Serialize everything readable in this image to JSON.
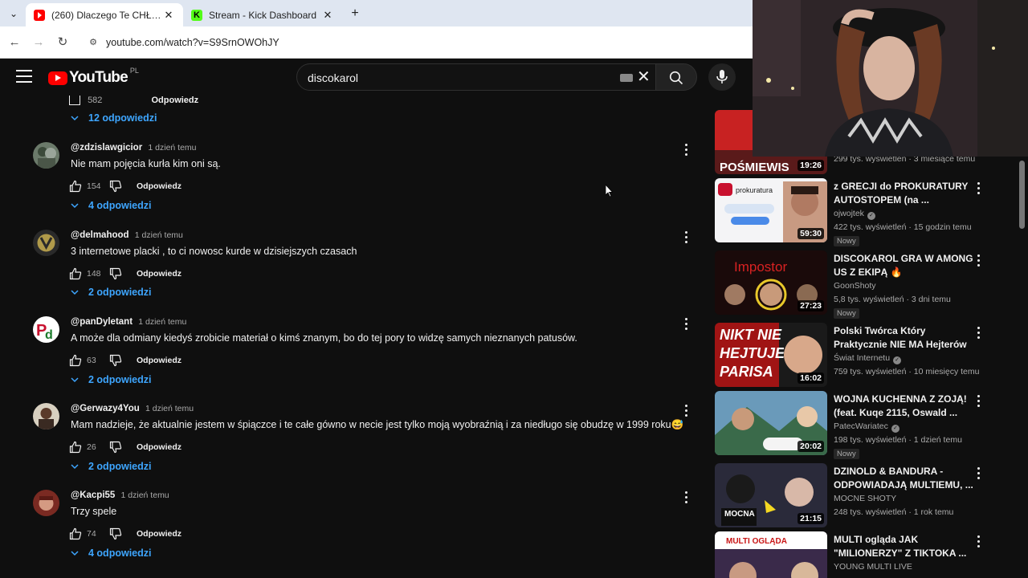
{
  "browser": {
    "tabs": [
      {
        "title": "(260) Dlaczego Te CHŁOPAKI P…",
        "favicon": "youtube-icon",
        "active": true
      },
      {
        "title": "Stream - Kick Dashboard",
        "favicon": "kick-icon",
        "active": false
      }
    ],
    "url": "youtube.com/watch?v=S9SrnOWOhJY"
  },
  "header": {
    "logo_text": "YouTube",
    "country_code": "PL",
    "search_query": "discokarol"
  },
  "comments": {
    "top_partial": {
      "likes": "582",
      "reply_label": "Odpowiedz"
    },
    "first_replies_label": "12 odpowiedzi",
    "items": [
      {
        "author": "@zdzislawgicior",
        "time": "1 dzień temu",
        "text": "Nie mam pojęcia kurła kim oni są.",
        "likes": "154",
        "reply_label": "Odpowiedz",
        "replies_label": "4 odpowiedzi"
      },
      {
        "author": "@delmahood",
        "time": "1 dzień temu",
        "text": "3 internetowe placki , to ci nowosc kurde w dzisiejszych czasach",
        "likes": "148",
        "reply_label": "Odpowiedz",
        "replies_label": "2 odpowiedzi"
      },
      {
        "author": "@panDyletant",
        "time": "1 dzień temu",
        "text": "A może dla odmiany kiedyś zrobicie materiał o kimś znanym, bo do tej pory to widzę samych nieznanych patusów.",
        "likes": "63",
        "reply_label": "Odpowiedz",
        "replies_label": "2 odpowiedzi"
      },
      {
        "author": "@Gerwazy4You",
        "time": "1 dzień temu",
        "text": "Mam nadzieje, że aktualnie jestem w śpiączce i te całe gówno w necie jest tylko moją wyobraźnią i za niedługo się obudzę w 1999 roku😅",
        "likes": "26",
        "reply_label": "Odpowiedz",
        "replies_label": "2 odpowiedzi"
      },
      {
        "author": "@Kacpi55",
        "time": "1 dzień temu",
        "text": "Trzy spele",
        "likes": "74",
        "reply_label": "Odpowiedz",
        "replies_label": "4 odpowiedzi"
      }
    ]
  },
  "recommendations": [
    {
      "title": "",
      "channel": "",
      "meta": "299 tys. wyświetleń · 3 miesiące temu",
      "duration": "19:26",
      "thumb_text": "POŚMIEWIS",
      "badge": ""
    },
    {
      "title": "z GRECJI do PROKURATURY AUTOSTOPEM (na ...",
      "channel": "ojwojtek",
      "verified": true,
      "meta": "422 tys. wyświetleń · 15 godzin temu",
      "duration": "59:30",
      "thumb_text": "prokuratura",
      "badge": "Nowy"
    },
    {
      "title": "DISCOKAROL GRA W AMONG US Z EKIPĄ 🔥",
      "channel": "GoonShoty",
      "verified": false,
      "meta": "5,8 tys. wyświetleń · 3 dni temu",
      "duration": "27:23",
      "thumb_text": "Impostor",
      "badge": "Nowy"
    },
    {
      "title": "Polski Twórca Który Praktycznie NIE MA Hejterów",
      "channel": "Świat Internetu",
      "verified": true,
      "meta": "759 tys. wyświetleń · 10 miesięcy temu",
      "duration": "16:02",
      "thumb_text": "NIKT NIE HEJTUJE PARISA",
      "badge": ""
    },
    {
      "title": "WOJNA KUCHENNA Z ZOJĄ! (feat. Kuqe 2115, Oswald ...",
      "channel": "PatecWariatec",
      "verified": true,
      "meta": "198 tys. wyświetleń · 1 dzień temu",
      "duration": "20:02",
      "thumb_text": "",
      "badge": "Nowy"
    },
    {
      "title": "DZINOLD & BANDURA - ODPOWIADAJĄ MULTIEMU, ...",
      "channel": "MOCNE SHOTY",
      "verified": false,
      "meta": "248 tys. wyświetleń · 1 rok temu",
      "duration": "21:15",
      "thumb_text": "MOCNA",
      "badge": ""
    },
    {
      "title": "MULTI ogląda JAK \"MILIONERZY\" Z TIKTOKA ...",
      "channel": "YOUNG MULTI LIVE",
      "verified": false,
      "meta": "",
      "duration": "",
      "thumb_text": "MULTI OGLĄDA",
      "badge": ""
    }
  ],
  "colors": {
    "background": "#0f0f0f",
    "link_blue": "#3ea6ff",
    "brand_red": "#ff0000",
    "kick_green": "#53fc18"
  }
}
